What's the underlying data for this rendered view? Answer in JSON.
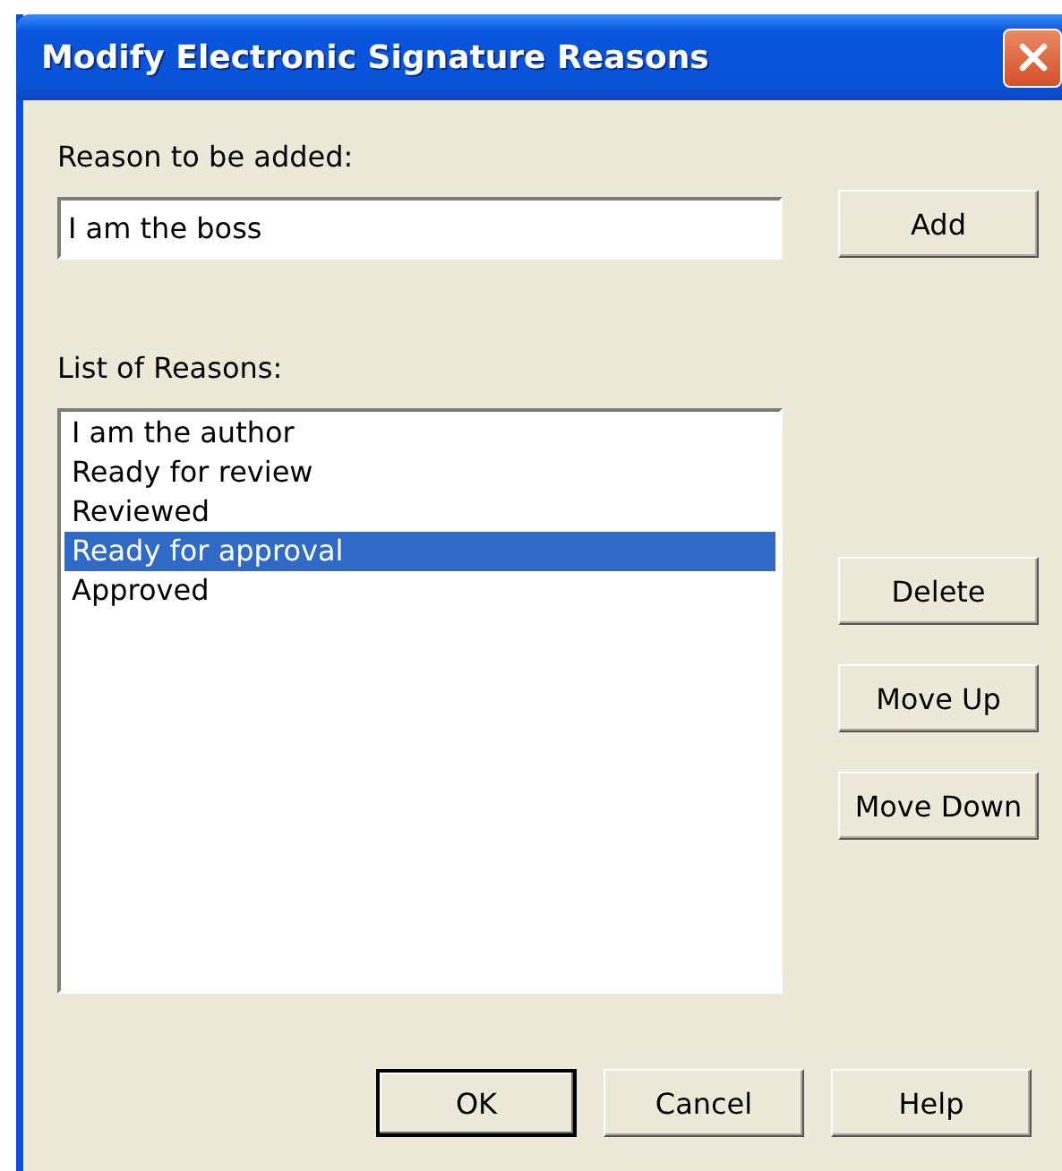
{
  "window": {
    "title": "Modify Electronic Signature Reasons"
  },
  "reason_field": {
    "label": "Reason to be added:",
    "value": "I am the boss"
  },
  "add_button": "Add",
  "reasons": {
    "label": "List of Reasons:",
    "items": [
      {
        "text": "I am the author",
        "selected": false
      },
      {
        "text": "Ready for review",
        "selected": false
      },
      {
        "text": "Reviewed",
        "selected": false
      },
      {
        "text": "Ready for approval",
        "selected": true
      },
      {
        "text": "Approved",
        "selected": false
      }
    ]
  },
  "side_buttons": [
    "Delete",
    "Move Up",
    "Move Down"
  ],
  "footer_buttons": [
    {
      "label": "OK",
      "default": true
    },
    {
      "label": "Cancel",
      "default": false
    },
    {
      "label": "Help",
      "default": false
    }
  ]
}
